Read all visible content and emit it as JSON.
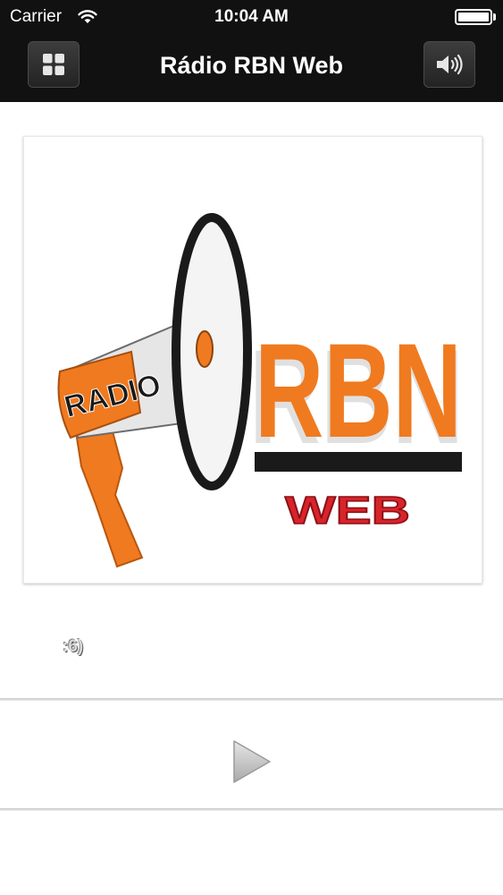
{
  "status_bar": {
    "carrier": "Carrier",
    "time": "10:04 AM"
  },
  "nav": {
    "title": "Rádio RBN Web"
  },
  "logo": {
    "radio_text": "RADIO",
    "brand_text": "RBN",
    "web_text": "WEB"
  },
  "now_playing": {
    "text": ":6)"
  },
  "colors": {
    "nav_bg": "#111111",
    "brand_orange": "#f07a1f",
    "web_red": "#d8232a"
  }
}
